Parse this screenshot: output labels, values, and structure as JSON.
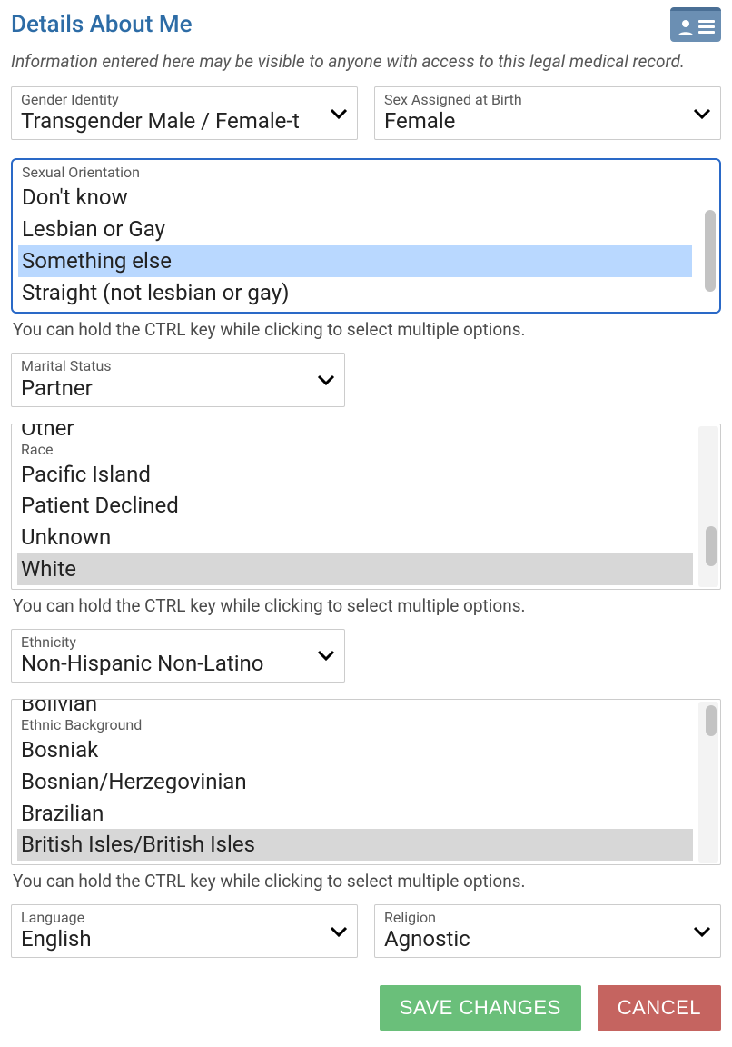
{
  "header": {
    "title": "Details About Me",
    "intro": "Information entered here may be visible to anyone with access to this legal medical record."
  },
  "fields": {
    "gender_identity": {
      "label": "Gender Identity",
      "value": "Transgender Male / Female-t"
    },
    "sex_assigned": {
      "label": "Sex Assigned at Birth",
      "value": "Female"
    },
    "sexual_orientation": {
      "label": "Sexual Orientation",
      "options": [
        "Don't know",
        "Lesbian or Gay",
        "Something else",
        "Straight (not lesbian or gay)"
      ],
      "selected": "Something else"
    },
    "marital_status": {
      "label": "Marital Status",
      "value": "Partner"
    },
    "race": {
      "label": "Race",
      "partial_top": "",
      "options": [
        "Pacific Island",
        "Patient Declined",
        "Unknown",
        "White"
      ],
      "selected": "White"
    },
    "ethnicity": {
      "label": "Ethnicity",
      "value": "Non-Hispanic Non-Latino"
    },
    "ethnic_background": {
      "label": "Ethnic Background",
      "partial_top": "",
      "options": [
        "Bosniak",
        "Bosnian/Herzegovinian",
        "Brazilian",
        "British Isles/British Isles"
      ],
      "selected": "British Isles/British Isles"
    },
    "language": {
      "label": "Language",
      "value": "English"
    },
    "religion": {
      "label": "Religion",
      "value": "Agnostic"
    }
  },
  "hints": {
    "multi": "You can hold the CTRL key while clicking to select multiple options."
  },
  "buttons": {
    "save": "SAVE CHANGES",
    "cancel": "CANCEL"
  }
}
